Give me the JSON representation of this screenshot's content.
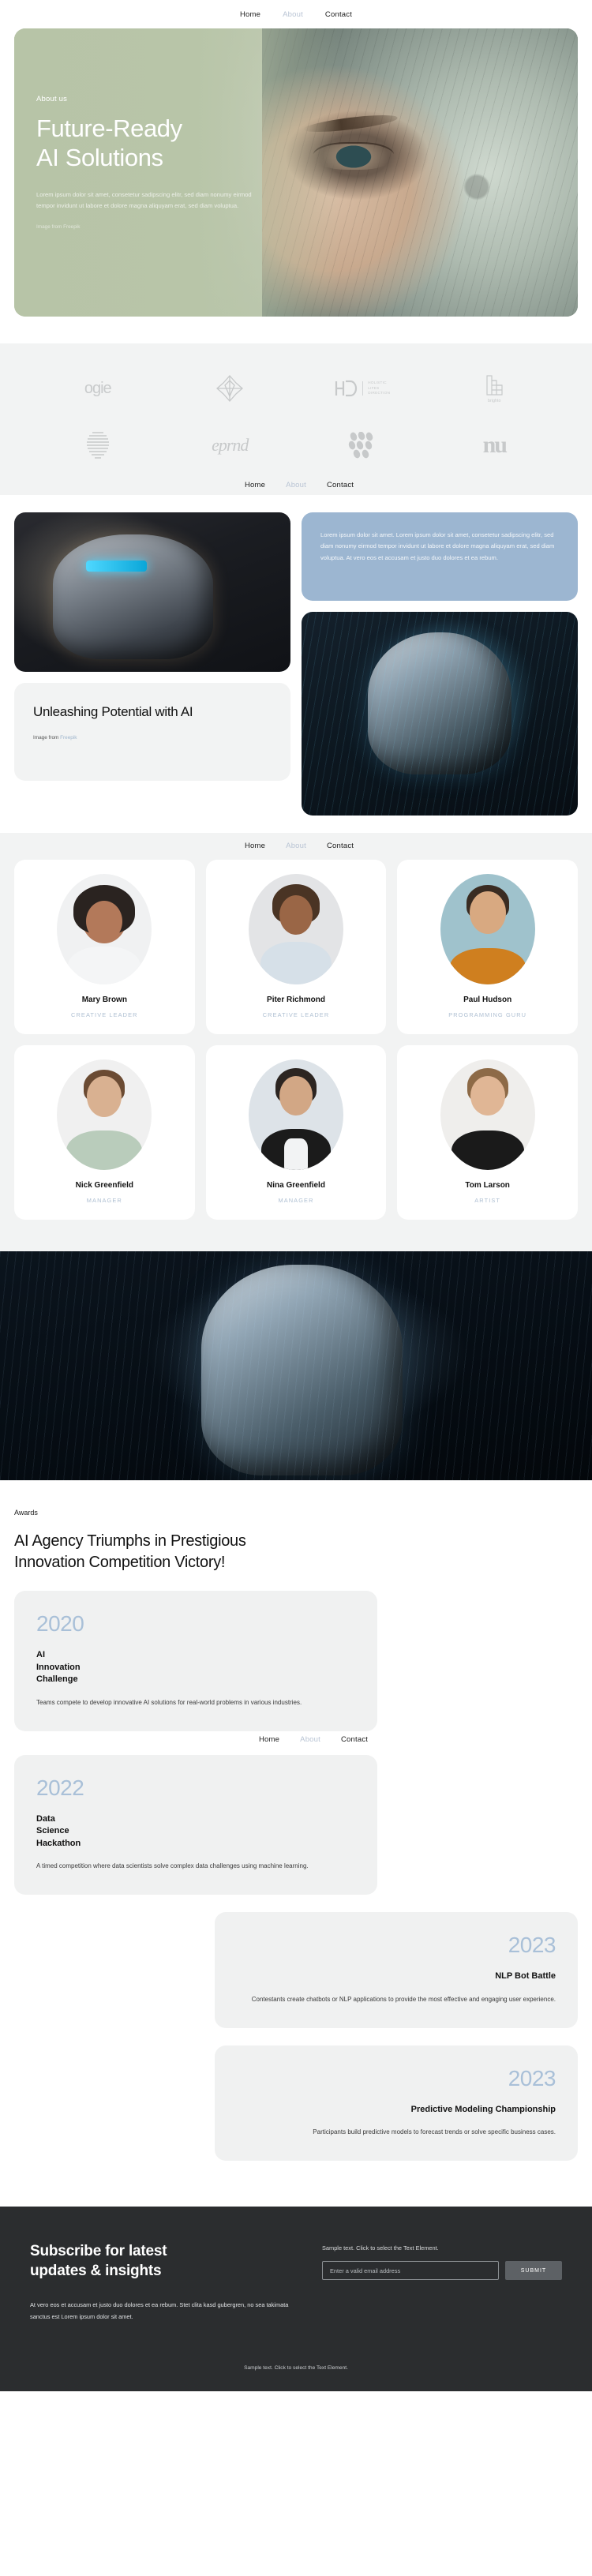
{
  "nav": {
    "items": [
      {
        "label": "Home",
        "muted": false
      },
      {
        "label": "About",
        "muted": true
      },
      {
        "label": "Contact",
        "muted": false
      }
    ]
  },
  "hero": {
    "eyebrow": "About us",
    "title": "Future-Ready\nAI Solutions",
    "body": "Lorem ipsum dolor sit amet, consetetur sadipscing elitr, sed diam nonumy eirmod tempor invidunt ut labore et dolore magna aliquyam erat, sed diam voluptua.",
    "credit": "Image from Freepik",
    "accent": "#b8c5a8"
  },
  "logos": {
    "row1": [
      {
        "name": "ogie",
        "type": "wordmark"
      },
      {
        "name": "flower-mark",
        "type": "glyph"
      },
      {
        "name": "HD Holistic Lifes Direction",
        "type": "hd",
        "line1": "HOLISTIC",
        "line2": "LIFES",
        "line3": "DIRECTION",
        "mark": "HD"
      },
      {
        "name": "brighto",
        "type": "brighto",
        "label": "brighto"
      }
    ],
    "row2": [
      {
        "name": "striped-oval",
        "type": "glyph"
      },
      {
        "name": "eprnd",
        "type": "wordmark",
        "label": "eprnd"
      },
      {
        "name": "dots-cluster",
        "type": "glyph"
      },
      {
        "name": "nu",
        "type": "wordmark",
        "label": "nu"
      }
    ]
  },
  "showcase": {
    "blue_card_text": "Lorem ipsum dolor sit amet. Lorem ipsum dolor sit amet, consetetur sadipscing elitr, sed diam nonumy eirmod tempor invidunt ut labore et dolore magna aliquyam erat, sed diam voluptua. At vero eos et accusam et justo duo dolores et ea rebum.",
    "card_title": "Unleashing\nPotential with AI",
    "card_credit_prefix": "Image from ",
    "card_credit_link": "Freepik",
    "blue_color": "#9cb6d1"
  },
  "team": {
    "members": [
      {
        "name": "Mary Brown",
        "role": "CREATIVE LEADER",
        "skin": "#b3795a",
        "hair": "#2a2320",
        "shirt": "#f4f5f6",
        "bg": "#f0f1f2"
      },
      {
        "name": "Piter Richmond",
        "role": "CREATIVE LEADER",
        "skin": "#9a6646",
        "hair": "#4a3424",
        "shirt": "#d6e0e8",
        "bg": "#e3e4e6"
      },
      {
        "name": "Paul Hudson",
        "role": "PROGRAMMING GURU",
        "skin": "#d8a981",
        "hair": "#3a2c22",
        "shirt": "#cf7f1f",
        "bg": "#9fc2cc"
      },
      {
        "name": "Nick Greenfield",
        "role": "MANAGER",
        "skin": "#d9b191",
        "hair": "#6b4b33",
        "shirt": "#b9ccbb",
        "bg": "#f0f0f0"
      },
      {
        "name": "Nina Greenfield",
        "role": "MANAGER",
        "skin": "#d2a785",
        "hair": "#2c2521",
        "shirt": "#1b1b1b",
        "bg": "#dde3e8"
      },
      {
        "name": "Tom Larson",
        "role": "ARTIST",
        "skin": "#e0b695",
        "hair": "#8d6a47",
        "shirt": "#1a1a1a",
        "bg": "#efeeec"
      }
    ],
    "role_color": "#aebfd2"
  },
  "awards": {
    "eyebrow": "Awards",
    "title": "AI Agency Triumphs in Prestigious\nInnovation Competition Victory!",
    "year_color": "#a9c0d8",
    "cards": [
      {
        "year": "2020",
        "name": "AI\nInnovation\nChallenge",
        "desc": "Teams compete to develop innovative AI solutions for real-world problems in various industries.",
        "align": "left"
      },
      {
        "year": "2022",
        "name": "Data\nScience\nHackathon",
        "desc": "A timed competition where data scientists solve complex data challenges using machine learning.",
        "align": "left"
      },
      {
        "year": "2023",
        "name": "NLP Bot Battle",
        "desc": "Contestants create chatbots or NLP applications to provide the most effective and engaging user experience.",
        "align": "right"
      },
      {
        "year": "2023",
        "name": "Predictive Modeling Championship",
        "desc": "Participants build predictive models to forecast trends or solve specific business cases.",
        "align": "right"
      }
    ]
  },
  "footer": {
    "title": "Subscribe for latest\nupdates & insights",
    "note": "Sample text. Click to select the Text Element.",
    "email_placeholder": "Enter a valid email address",
    "email_value": "",
    "submit_label": "SUBMIT",
    "body": "At vero eos et accusam et justo duo dolores et ea rebum. Stet clita kasd gubergren, no sea takimata sanctus est Lorem ipsum dolor sit amet.",
    "bottom": "Sample text. Click to select the Text Element.",
    "bg": "#2b2d2f"
  }
}
